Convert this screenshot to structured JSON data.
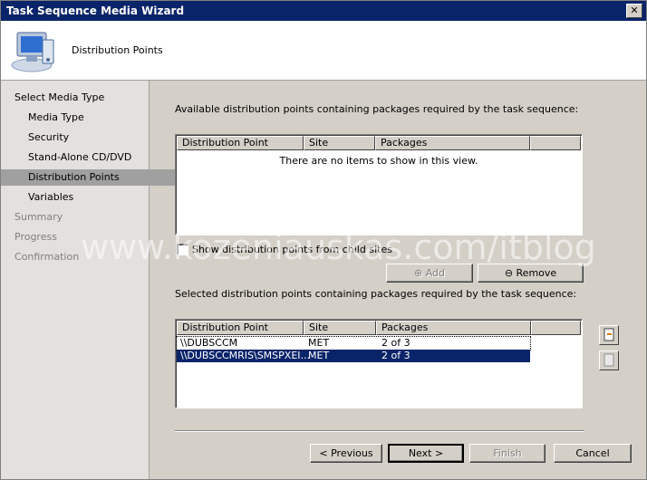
{
  "window": {
    "title": "Task Sequence Media Wizard",
    "close_glyph": "✕"
  },
  "header": {
    "heading": "Distribution Points",
    "icon": "computer-disc-icon"
  },
  "nav": {
    "items": [
      {
        "label": "Select Media Type",
        "level": 1,
        "state": "normal"
      },
      {
        "label": "Media Type",
        "level": 2,
        "state": "normal"
      },
      {
        "label": "Security",
        "level": 2,
        "state": "normal"
      },
      {
        "label": "Stand-Alone CD/DVD",
        "level": 2,
        "state": "normal"
      },
      {
        "label": "Distribution Points",
        "level": 2,
        "state": "active"
      },
      {
        "label": "Variables",
        "level": 2,
        "state": "normal"
      },
      {
        "label": "Summary",
        "level": 1,
        "state": "disabled"
      },
      {
        "label": "Progress",
        "level": 1,
        "state": "disabled"
      },
      {
        "label": "Confirmation",
        "level": 1,
        "state": "disabled"
      }
    ]
  },
  "available": {
    "label": "Available distribution points containing packages required by the task sequence:",
    "columns": [
      "Distribution Point",
      "Site",
      "Packages"
    ],
    "empty_message": "There are no items to show in this view."
  },
  "show_child_sites": {
    "label": "Show distribution points from child sites",
    "checked": false
  },
  "buttons": {
    "add": "Add",
    "remove": "Remove",
    "previous": "< Previous",
    "next": "Next >",
    "finish": "Finish",
    "cancel": "Cancel"
  },
  "selected": {
    "label": "Selected distribution points containing packages required by the task sequence:",
    "columns": [
      "Distribution Point",
      "Site",
      "Packages"
    ],
    "rows": [
      {
        "dp": "\\\\DUBSCCM",
        "site": "MET",
        "packages": "2 of 3"
      },
      {
        "dp": "\\\\DUBSCCMRIS\\SMSPXEI...",
        "site": "MET",
        "packages": "2 of 3"
      }
    ]
  },
  "watermark": "www.kozeniauskas.com/itblog"
}
